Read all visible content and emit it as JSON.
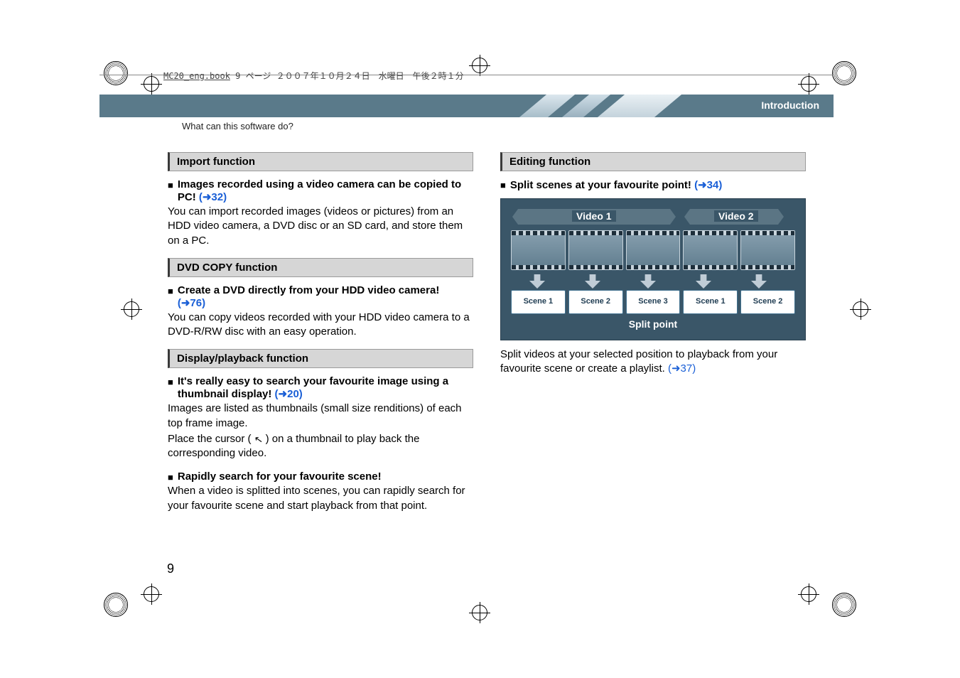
{
  "file_tag": {
    "name": "MC20_eng.book",
    "rest": "  9 ページ  ２００７年１０月２４日　水曜日　午後２時１分"
  },
  "banner": {
    "label": "Introduction"
  },
  "subheader": "What can this software do?",
  "page_number": "9",
  "left": {
    "import": {
      "title": "Import function",
      "bullet_text_a": "Images recorded using a video camera can be copied to PC!",
      "bullet_link": " (➜32)",
      "body": "You can import recorded images (videos or pictures) from an HDD video camera, a DVD disc or an SD card, and store them on a PC."
    },
    "dvd": {
      "title": "DVD COPY function",
      "bullet_text": "Create a DVD directly from your HDD video camera!",
      "bullet_link": "(➜76)",
      "body": "You can copy videos recorded with your HDD video camera to a DVD-R/RW disc with an easy operation."
    },
    "display": {
      "title": "Display/playback function",
      "b1_text": "It's really easy to search your favourite image using a thumbnail display!",
      "b1_link": " (➜20)",
      "b1_body_a": "Images are listed as thumbnails (small size renditions) of each top frame image.",
      "b1_body_b_pre": "Place the cursor ( ",
      "b1_body_b_post": " ) on a thumbnail to play back the corresponding video.",
      "b2_text": "Rapidly search for your favourite scene!",
      "b2_body": "When a video is splitted into scenes, you can rapidly search for your favourite scene and start playback from that point."
    }
  },
  "right": {
    "edit": {
      "title": "Editing function",
      "bullet_text": "Split scenes at your favourite point!",
      "bullet_link": " (➜34)",
      "diagram": {
        "video1": "Video 1",
        "video2": "Video 2",
        "scenes_v1": [
          "Scene 1",
          "Scene 2",
          "Scene 3"
        ],
        "scenes_v2": [
          "Scene 1",
          "Scene 2"
        ],
        "split": "Split point"
      },
      "body_a": "Split videos at your selected position to playback from your favourite scene or create a playlist.",
      "body_link": " (➜37)"
    }
  }
}
